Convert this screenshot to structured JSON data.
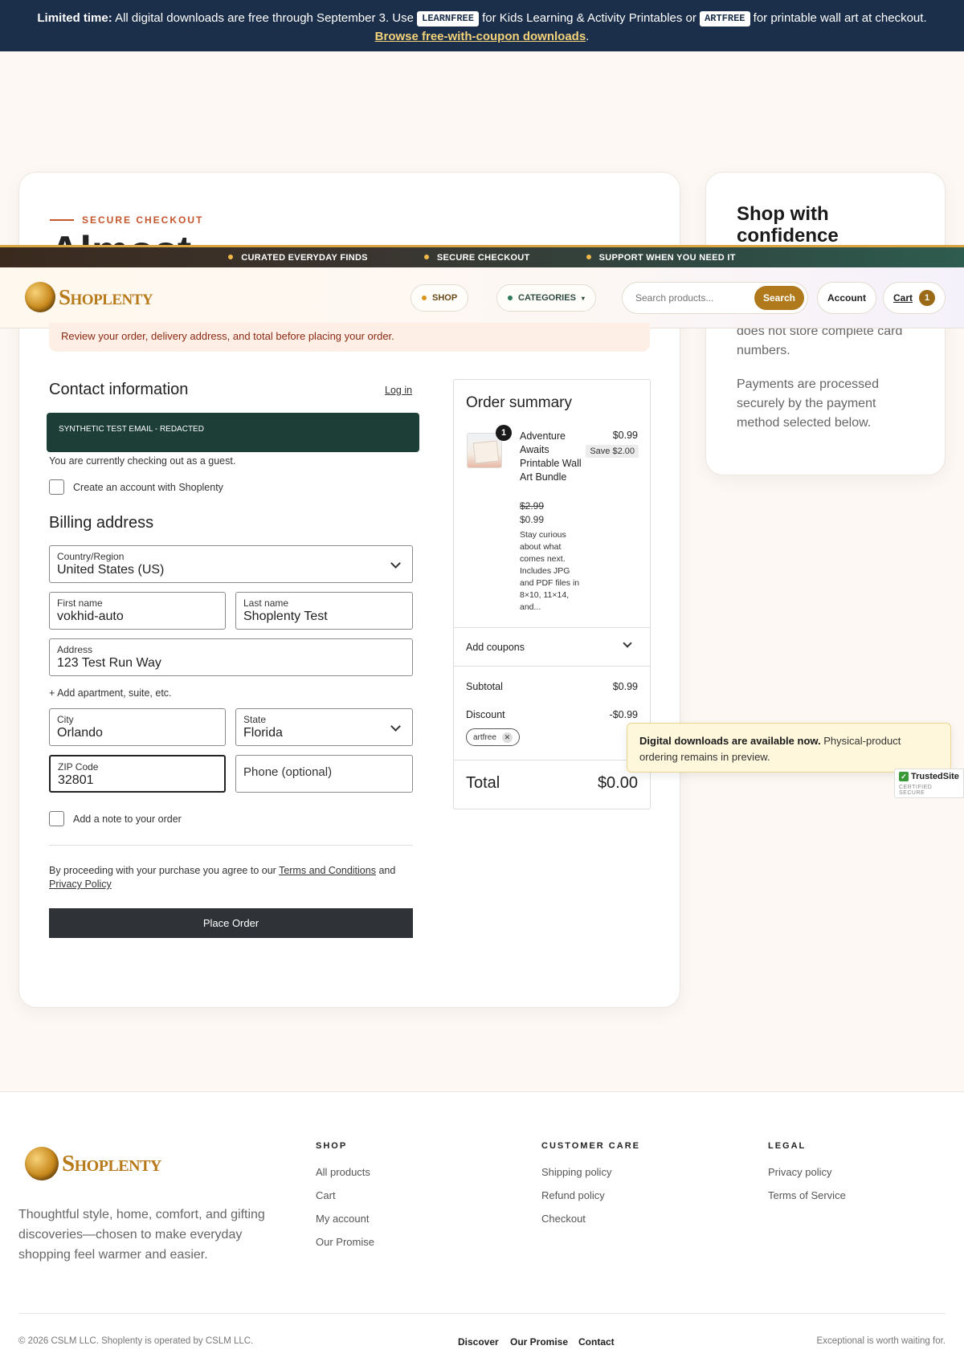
{
  "announcement": {
    "lead": "Limited time:",
    "text1": " All digital downloads are free through September 3. Use ",
    "code1": "LEARNFREE",
    "text2": " for Kids Learning & Activity Printables or ",
    "code2": "ARTFREE",
    "text3": " for printable wall art at checkout.",
    "link": "Browse free-with-coupon downloads",
    "link_suffix": "."
  },
  "main": {
    "kicker": "SECURE CHECKOUT",
    "title_partial": "Almost",
    "notice": "Review your order, delivery address, and total before placing your order."
  },
  "side": {
    "title": "Shop with confidence",
    "text1": "does not store complete card numbers.",
    "text2": "Payments are processed securely by the payment method selected below."
  },
  "ribbon": [
    "CURATED EVERYDAY FINDS",
    "SECURE CHECKOUT",
    "SUPPORT WHEN YOU NEED IT"
  ],
  "header": {
    "logo": "Shoplenty",
    "shop": "SHOP",
    "categories": "CATEGORIES",
    "search_placeholder": "Search products...",
    "search_button": "Search",
    "account": "Account",
    "cart": "Cart",
    "cart_count": "1"
  },
  "contact": {
    "title": "Contact information",
    "login": "Log in",
    "email": "SYNTHETIC TEST EMAIL - REDACTED",
    "guest_note": "You are currently checking out as a guest.",
    "create_account": "Create an account with Shoplenty"
  },
  "billing": {
    "title": "Billing address",
    "country_label": "Country/Region",
    "country": "United States (US)",
    "first_label": "First name",
    "first": "vokhid-auto",
    "last_label": "Last name",
    "last": "Shoplenty Test",
    "address_label": "Address",
    "address": "123 Test Run Way",
    "add_apt": "+ Add apartment, suite, etc.",
    "city_label": "City",
    "city": "Orlando",
    "state_label": "State",
    "state": "Florida",
    "zip_label": "ZIP Code",
    "zip": "32801",
    "phone_placeholder": "Phone (optional)",
    "note": "Add a note to your order"
  },
  "terms": {
    "pre": "By proceeding with your purchase you agree to our ",
    "terms": "Terms and Conditions",
    "mid": " and ",
    "privacy": "Privacy Policy"
  },
  "place_order": "Place Order",
  "summary": {
    "title": "Order summary",
    "item": {
      "qty": "1",
      "name": "Adventure Awaits Printable Wall Art Bundle",
      "price": "$0.99",
      "save": "Save $2.00",
      "old_price": "$2.99",
      "new_price": "$0.99",
      "desc": "Stay curious about what comes next. Includes JPG and PDF files in 8×10, 11×14, and..."
    },
    "coupons": "Add coupons",
    "subtotal_label": "Subtotal",
    "subtotal": "$0.99",
    "discount_label": "Discount",
    "discount": "-$0.99",
    "coupon_code": "artfree",
    "total_label": "Total",
    "total": "$0.00"
  },
  "toast": {
    "bold": "Digital downloads are available now.",
    "rest": " Physical-product ordering remains in preview."
  },
  "trusted": {
    "name": "TrustedSite",
    "sub": "CERTIFIED SECURE"
  },
  "footer": {
    "tagline": "Thoughtful style, home, comfort, and gifting discoveries—chosen to make everyday shopping feel warmer and easier.",
    "shop_title": "SHOP",
    "shop_links": [
      "All products",
      "Cart",
      "My account",
      "Our Promise"
    ],
    "care_title": "CUSTOMER CARE",
    "care_links": [
      "Shipping policy",
      "Refund policy",
      "Checkout"
    ],
    "legal_title": "LEGAL",
    "legal_links": [
      "Privacy policy",
      "Terms of Service"
    ],
    "copyright": "© 2026 CSLM LLC. Shoplenty is operated by CSLM LLC.",
    "bottom_links": [
      "Discover",
      "Our Promise",
      "Contact"
    ],
    "motto": "Exceptional is worth waiting for."
  },
  "colors": {
    "navy": "#1c2f4a",
    "gold": "#b07a1c",
    "green": "#1d3e36",
    "accent": "#c4562c"
  }
}
